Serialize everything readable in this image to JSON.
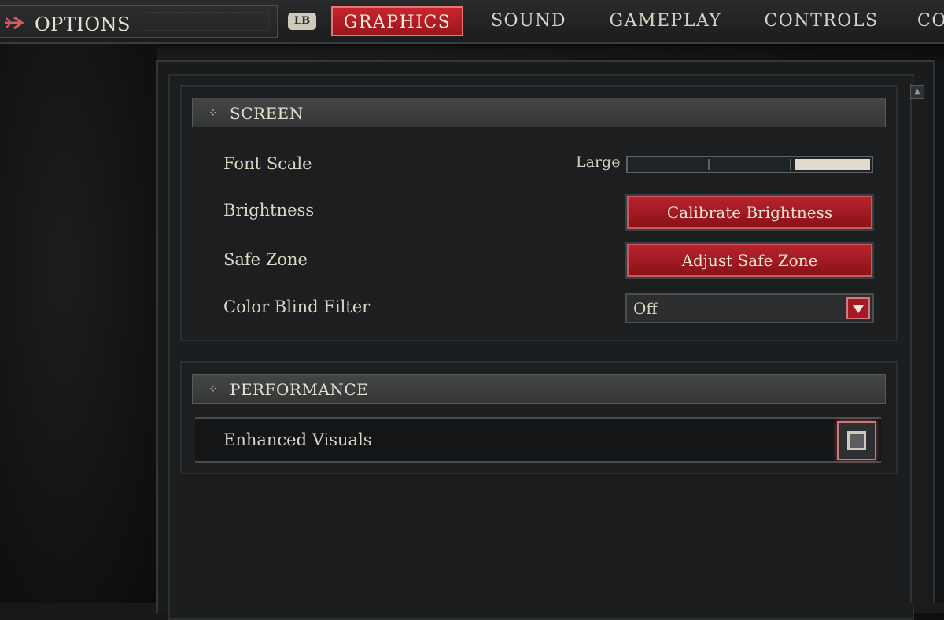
{
  "nav": {
    "title": "OPTIONS",
    "bumper_left": "LB",
    "tabs": [
      {
        "label": "GRAPHICS",
        "active": true
      },
      {
        "label": "SOUND",
        "active": false
      },
      {
        "label": "GAMEPLAY",
        "active": false
      },
      {
        "label": "CONTROLS",
        "active": false
      },
      {
        "label": "CO",
        "active": false
      }
    ]
  },
  "screen": {
    "header": "SCREEN",
    "font_scale": {
      "label": "Font Scale",
      "value": "Large",
      "level": 3,
      "levels": 3
    },
    "brightness": {
      "label": "Brightness",
      "button": "Calibrate Brightness"
    },
    "safe_zone": {
      "label": "Safe Zone",
      "button": "Adjust Safe Zone"
    },
    "color_blind": {
      "label": "Color Blind Filter",
      "value": "Off"
    }
  },
  "performance": {
    "header": "PERFORMANCE",
    "enhanced_visuals": {
      "label": "Enhanced Visuals",
      "checked": false
    }
  },
  "colors": {
    "accent_red": "#b8222a",
    "text": "#ddd6c7",
    "background": "#1c1d1e"
  },
  "icons": [
    "back-arrow-icon",
    "diamond-bullet-icon",
    "chevron-down-icon",
    "scroll-up-icon"
  ]
}
